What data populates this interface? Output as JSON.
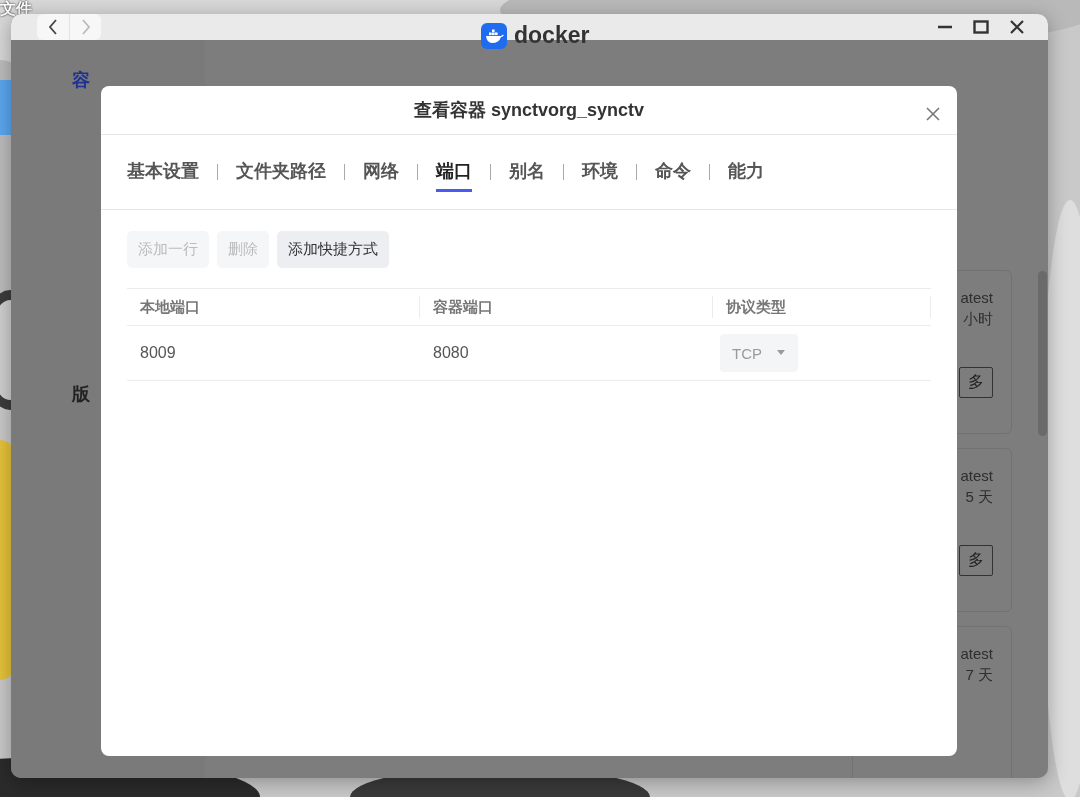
{
  "desktop": {
    "icon_labels": [
      "文件"
    ]
  },
  "window": {
    "title": "docker",
    "nav": [
      {
        "kind": "back",
        "disabled": false
      },
      {
        "kind": "forward",
        "disabled": true
      }
    ]
  },
  "sidebar": {
    "items": [
      {
        "label": "容",
        "selected": true
      },
      {
        "label": "版",
        "selected": false
      }
    ]
  },
  "cards": [
    {
      "tag": "atest",
      "age": "小时",
      "button": "多"
    },
    {
      "tag": "atest",
      "age": "5 天",
      "button": "多"
    },
    {
      "tag": "atest",
      "age": "7 天"
    }
  ],
  "dialog": {
    "title": "查看容器 synctvorg_synctv",
    "tabs": [
      {
        "label": "基本设置",
        "selected": false
      },
      {
        "label": "文件夹路径",
        "selected": false
      },
      {
        "label": "网络",
        "selected": false
      },
      {
        "label": "端口",
        "selected": true
      },
      {
        "label": "别名",
        "selected": false
      },
      {
        "label": "环境",
        "selected": false
      },
      {
        "label": "命令",
        "selected": false
      },
      {
        "label": "能力",
        "selected": false
      }
    ],
    "toolbar": [
      {
        "label": "添加一行",
        "disabled": true
      },
      {
        "label": "删除",
        "disabled": true
      },
      {
        "label": "添加快捷方式",
        "disabled": false
      }
    ],
    "table": {
      "columns": [
        "本地端口",
        "容器端口",
        "协议类型"
      ],
      "rows": [
        {
          "local_port": "8009",
          "container_port": "8080",
          "protocol": {
            "value": "TCP",
            "disabled": true
          }
        }
      ]
    }
  }
}
